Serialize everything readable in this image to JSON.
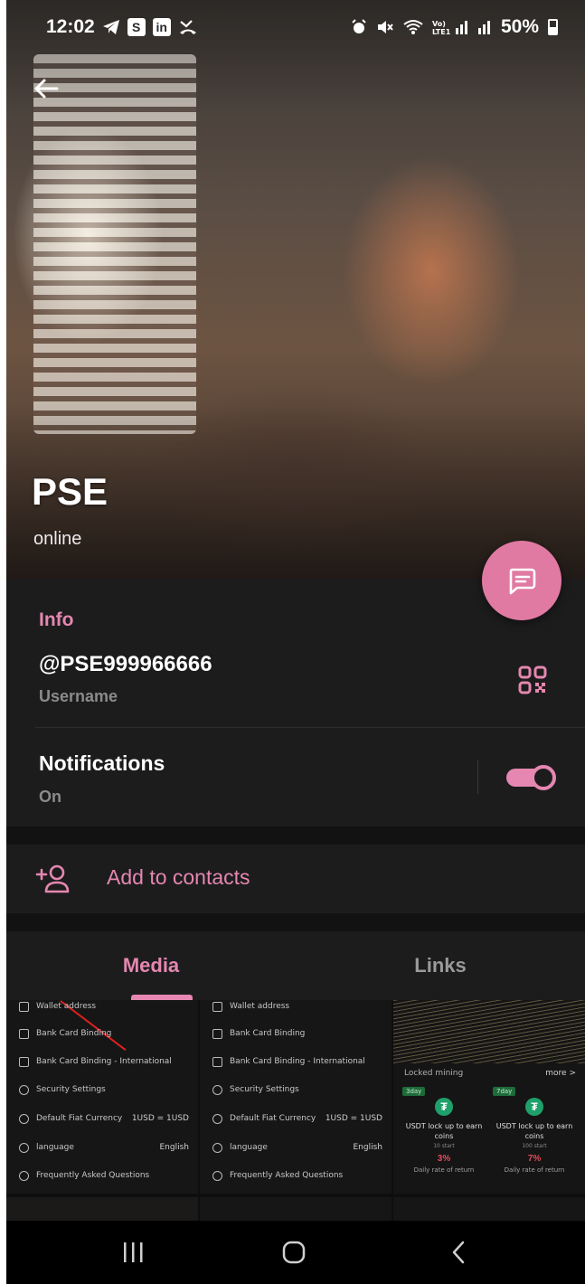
{
  "status_bar": {
    "time": "12:02",
    "battery": "50%"
  },
  "profile": {
    "name": "PSE",
    "status": "online"
  },
  "info": {
    "section_title": "Info",
    "username": "@PSE999966666",
    "username_label": "Username",
    "notifications_title": "Notifications",
    "notifications_state": "On",
    "notifications_enabled": true
  },
  "actions": {
    "add_to_contacts": "Add to contacts"
  },
  "tabs": {
    "media": "Media",
    "links": "Links",
    "active": "Media"
  },
  "media_thumbnails": {
    "settings_rows": [
      {
        "label": "Wallet address",
        "value": ""
      },
      {
        "label": "Bank Card Binding",
        "value": ""
      },
      {
        "label": "Bank Card Binding - International",
        "value": ""
      },
      {
        "label": "Security Settings",
        "value": ""
      },
      {
        "label": "Default Fiat Currency",
        "value": "1USD = 1USD"
      },
      {
        "label": "language",
        "value": "English"
      },
      {
        "label": "Frequently Asked Questions",
        "value": ""
      }
    ],
    "mining": {
      "header": "Locked mining",
      "more": "more >",
      "cards": [
        {
          "tag": "3day",
          "title": "USDT lock up to earn coins",
          "start": "10 start",
          "rate": "3%",
          "rate_label": "Daily rate of return"
        },
        {
          "tag": "7day",
          "title": "USDT lock up to earn coins",
          "start": "100 start",
          "rate": "7%",
          "rate_label": "Daily rate of return"
        }
      ]
    }
  },
  "colors": {
    "accent": "#e587b0",
    "fab": "#e07aa3",
    "background": "#121212",
    "card": "#1c1c1d",
    "muted_text": "#8b8b8b"
  },
  "icons": {
    "back": "arrow-left-icon",
    "fab": "chat-message-icon",
    "qr": "qr-code-icon",
    "add_contact": "add-person-icon",
    "nav_recents": "recents-icon",
    "nav_home": "home-icon",
    "nav_back": "chevron-back-icon"
  }
}
